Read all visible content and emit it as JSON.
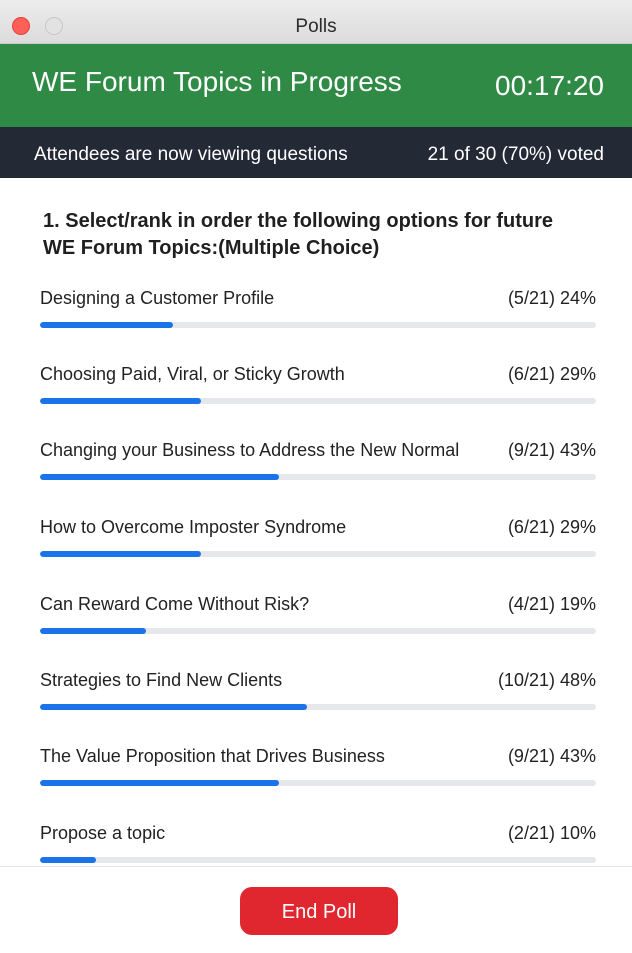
{
  "window": {
    "title": "Polls"
  },
  "header": {
    "poll_title": "WE Forum Topics in Progress",
    "timer": "00:17:20"
  },
  "status": {
    "message": "Attendees are now viewing questions",
    "votes": "21 of 30 (70%) voted"
  },
  "question": {
    "text": "1. Select/rank in order the following options for future WE Forum Topics:(Multiple Choice)",
    "options": [
      {
        "label": "Designing a Customer Profile",
        "result": "(5/21) 24%",
        "percent": 24
      },
      {
        "label": "Choosing Paid, Viral, or Sticky Growth",
        "result": "(6/21) 29%",
        "percent": 29
      },
      {
        "label": "Changing your Business to Address the New Normal",
        "result": "(9/21) 43%",
        "percent": 43
      },
      {
        "label": "How to Overcome Imposter Syndrome",
        "result": "(6/21) 29%",
        "percent": 29
      },
      {
        "label": "Can Reward Come Without Risk?",
        "result": "(4/21) 19%",
        "percent": 19
      },
      {
        "label": "Strategies to Find New Clients",
        "result": "(10/21) 48%",
        "percent": 48
      },
      {
        "label": "The Value Proposition that Drives Business",
        "result": "(9/21) 43%",
        "percent": 43
      },
      {
        "label": "Propose a topic",
        "result": "(2/21) 10%",
        "percent": 10
      }
    ]
  },
  "footer": {
    "end_label": "End Poll"
  },
  "colors": {
    "header_green": "#2f8a45",
    "status_dark": "#242936",
    "progress_blue": "#1a73e8",
    "end_red": "#e0272f"
  }
}
